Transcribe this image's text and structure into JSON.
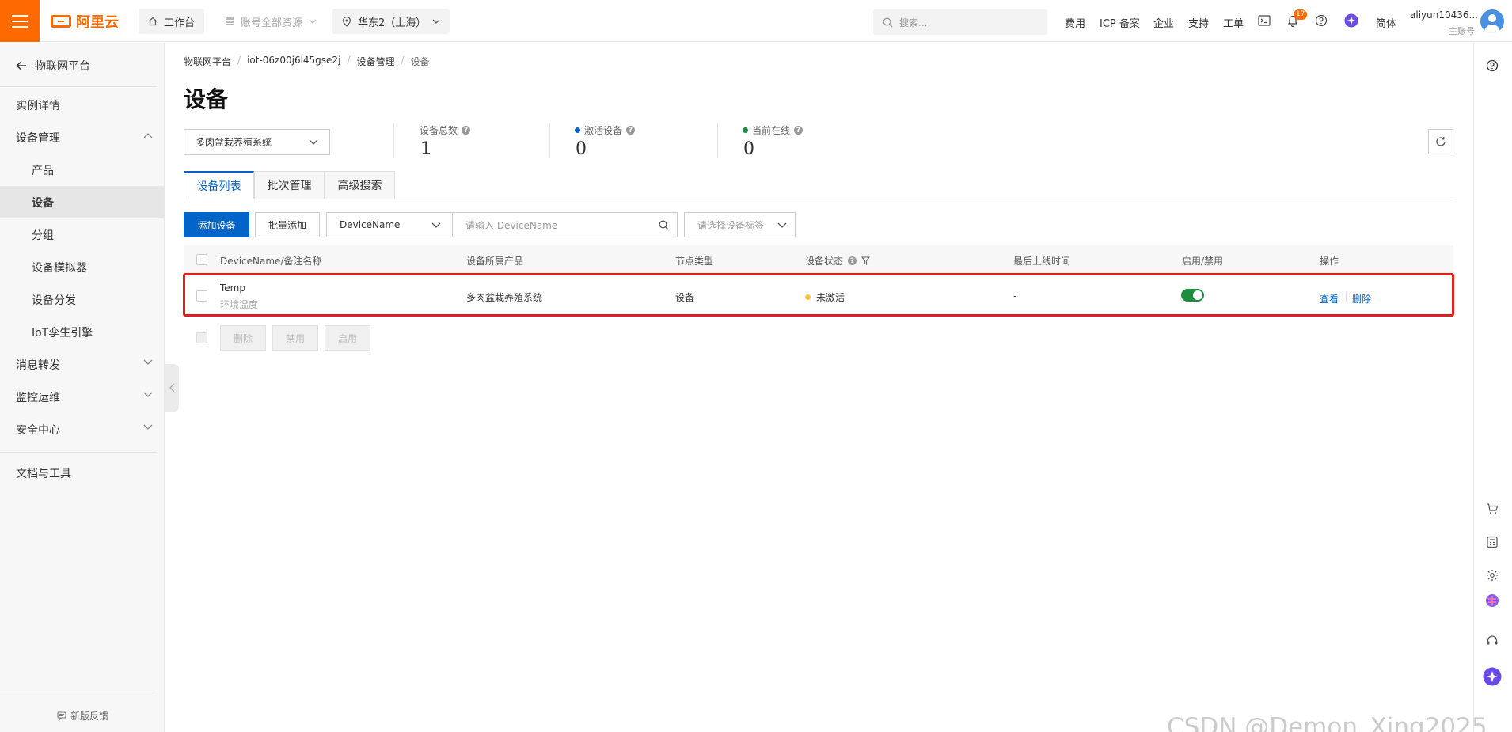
{
  "topbar": {
    "logo_text": "阿里云",
    "workbench": "工作台",
    "account_resources": "账号全部资源",
    "region": "华东2（上海）",
    "search_placeholder": "搜索...",
    "links": [
      "费用",
      "ICP 备案",
      "企业",
      "支持",
      "工单"
    ],
    "notification_count": "17",
    "language": "简体",
    "user_name": "aliyun10436...",
    "user_role": "主账号"
  },
  "sidebar": {
    "back_label": "物联网平台",
    "items": [
      {
        "label": "实例详情"
      },
      {
        "label": "设备管理"
      },
      {
        "label": "产品"
      },
      {
        "label": "设备"
      },
      {
        "label": "分组"
      },
      {
        "label": "设备模拟器"
      },
      {
        "label": "设备分发"
      },
      {
        "label": "IoT孪生引擎"
      },
      {
        "label": "消息转发"
      },
      {
        "label": "监控运维"
      },
      {
        "label": "安全中心"
      },
      {
        "label": "文档与工具"
      }
    ],
    "feedback": "新版反馈"
  },
  "breadcrumb": [
    "物联网平台",
    "iot-06z00j6l45gse2j",
    "设备管理",
    "设备"
  ],
  "page_title": "设备",
  "product_select": "多肉盆栽养殖系统",
  "stats": {
    "total_label": "设备总数",
    "total_value": "1",
    "active_label": "激活设备",
    "active_value": "0",
    "online_label": "当前在线",
    "online_value": "0"
  },
  "tabs": [
    "设备列表",
    "批次管理",
    "高级搜索"
  ],
  "toolbar": {
    "add_device": "添加设备",
    "batch_add": "批量添加",
    "field_select": "DeviceName",
    "search_placeholder": "请输入 DeviceName",
    "tag_placeholder": "请选择设备标签"
  },
  "table": {
    "headers": [
      "DeviceName/备注名称",
      "设备所属产品",
      "节点类型",
      "设备状态",
      "最后上线时间",
      "启用/禁用",
      "操作"
    ],
    "rows": [
      {
        "name": "Temp",
        "note": "环境温度",
        "product": "多肉盆栽养殖系统",
        "node_type": "设备",
        "status": "未激活",
        "last_online": "-",
        "enabled": true,
        "action_view": "查看",
        "action_delete": "删除"
      }
    ]
  },
  "bulk_actions": [
    "删除",
    "禁用",
    "启用"
  ],
  "watermark": "CSDN @Demon_Xing2025",
  "colors": {
    "brand": "#ff6a00",
    "primary": "#0064c8",
    "highlight": "#e02020",
    "status_inactive": "#ffc440",
    "toggle_on": "#1e8e3e"
  }
}
